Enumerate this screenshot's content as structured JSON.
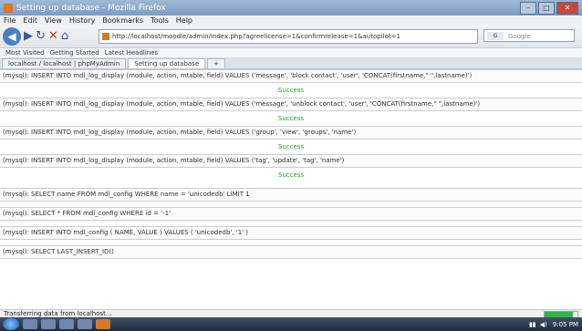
{
  "window": {
    "title": "Setting up database - Mozilla Firefox"
  },
  "menu": [
    "File",
    "Edit",
    "View",
    "History",
    "Bookmarks",
    "Tools",
    "Help"
  ],
  "nav": {
    "url": "http://localhost/moodle/admin/index.php?agreelicense=1&confirmrelease=1&autopilot=1",
    "search_placeholder": "Google",
    "search_engine": "G"
  },
  "bookmarks": [
    "Most Visited",
    "Getting Started",
    "Latest Headlines"
  ],
  "tabs": [
    {
      "label": "localhost / localhost | phpMyAdmin"
    },
    {
      "label": "Setting up database"
    }
  ],
  "log": [
    {
      "sql": "(mysql): INSERT INTO mdl_log_display (module, action, mtable, field) VALUES ('message', 'block contact', 'user', 'CONCAT(firstname,\" \",lastname)')",
      "result": "Success"
    },
    {
      "sql": "(mysql): INSERT INTO mdl_log_display (module, action, mtable, field) VALUES ('message', 'unblock contact', 'user', 'CONCAT(firstname,\" \",lastname)')",
      "result": "Success"
    },
    {
      "sql": "(mysql): INSERT INTO mdl_log_display (module, action, mtable, field) VALUES ('group', 'view', 'groups', 'name')",
      "result": "Success"
    },
    {
      "sql": "(mysql): INSERT INTO mdl_log_display (module, action, mtable, field) VALUES ('tag', 'update', 'tag', 'name')",
      "result": "Success"
    },
    {
      "sql": "(mysql): SELECT name FROM mdl_config WHERE name = 'unicodedb' LIMIT 1",
      "result": ""
    },
    {
      "sql": "(mysql): SELECT * FROM mdl_config WHERE id = '-1'",
      "result": ""
    },
    {
      "sql": "(mysql): INSERT INTO mdl_config ( NAME, VALUE ) VALUES ( 'unicodedb', '1' )",
      "result": ""
    },
    {
      "sql": "(mysql): SELECT LAST_INSERT_ID()",
      "result": ""
    }
  ],
  "status": {
    "text": "Transferring data from localhost...",
    "progress": 0.85
  },
  "taskbar": {
    "clock": "9:05 PM"
  }
}
